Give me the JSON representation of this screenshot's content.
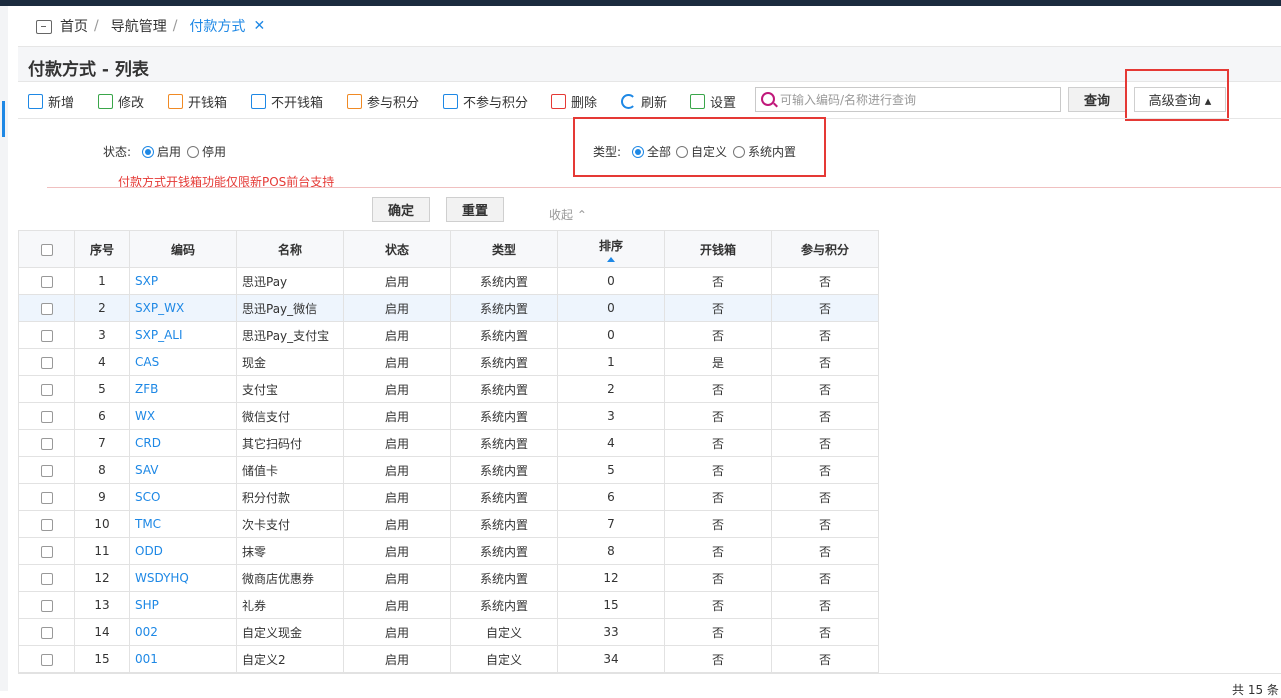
{
  "breadcrumb": {
    "home": "首页",
    "nav": "导航管理",
    "current": "付款方式"
  },
  "page_title": "付款方式 - 列表",
  "toolbar": {
    "add": "新增",
    "edit": "修改",
    "open_drawer": "开钱箱",
    "no_drawer": "不开钱箱",
    "points": "参与积分",
    "no_points": "不参与积分",
    "delete": "删除",
    "refresh": "刷新",
    "settings": "设置",
    "search_placeholder": "可输入编码/名称进行查询",
    "query": "查询",
    "advanced": "高级查询 ▴"
  },
  "filter": {
    "status_label": "状态:",
    "status_opts": [
      "启用",
      "停用"
    ],
    "type_label": "类型:",
    "type_opts": [
      "全部",
      "自定义",
      "系统内置"
    ],
    "hint": "付款方式开钱箱功能仅限新POS前台支持",
    "confirm": "确定",
    "reset": "重置",
    "collapse": "收起 ⌃"
  },
  "table": {
    "headers": [
      "序号",
      "编码",
      "名称",
      "状态",
      "类型",
      "排序",
      "开钱箱",
      "参与积分"
    ],
    "rows": [
      [
        "1",
        "SXP",
        "思迅Pay",
        "启用",
        "系统内置",
        "0",
        "否",
        "否"
      ],
      [
        "2",
        "SXP_WX",
        "思迅Pay_微信",
        "启用",
        "系统内置",
        "0",
        "否",
        "否"
      ],
      [
        "3",
        "SXP_ALI",
        "思迅Pay_支付宝",
        "启用",
        "系统内置",
        "0",
        "否",
        "否"
      ],
      [
        "4",
        "CAS",
        "现金",
        "启用",
        "系统内置",
        "1",
        "是",
        "否"
      ],
      [
        "5",
        "ZFB",
        "支付宝",
        "启用",
        "系统内置",
        "2",
        "否",
        "否"
      ],
      [
        "6",
        "WX",
        "微信支付",
        "启用",
        "系统内置",
        "3",
        "否",
        "否"
      ],
      [
        "7",
        "CRD",
        "其它扫码付",
        "启用",
        "系统内置",
        "4",
        "否",
        "否"
      ],
      [
        "8",
        "SAV",
        "储值卡",
        "启用",
        "系统内置",
        "5",
        "否",
        "否"
      ],
      [
        "9",
        "SCO",
        "积分付款",
        "启用",
        "系统内置",
        "6",
        "否",
        "否"
      ],
      [
        "10",
        "TMC",
        "次卡支付",
        "启用",
        "系统内置",
        "7",
        "否",
        "否"
      ],
      [
        "11",
        "ODD",
        "抹零",
        "启用",
        "系统内置",
        "8",
        "否",
        "否"
      ],
      [
        "12",
        "WSDYHQ",
        "微商店优惠券",
        "启用",
        "系统内置",
        "12",
        "否",
        "否"
      ],
      [
        "13",
        "SHP",
        "礼券",
        "启用",
        "系统内置",
        "15",
        "否",
        "否"
      ],
      [
        "14",
        "002",
        "自定义现金",
        "启用",
        "自定义",
        "33",
        "否",
        "否"
      ],
      [
        "15",
        "001",
        "自定义2",
        "启用",
        "自定义",
        "34",
        "否",
        "否"
      ]
    ]
  },
  "footer": {
    "count": "共 15 条"
  }
}
